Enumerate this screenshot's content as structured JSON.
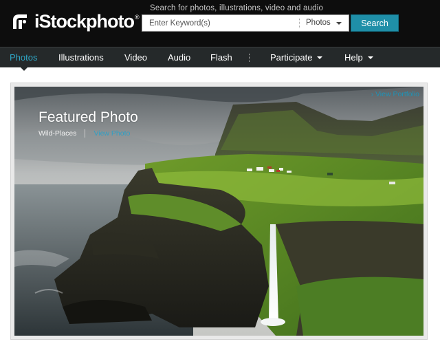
{
  "brand": {
    "name": "iStockphoto",
    "trademark": "®"
  },
  "search": {
    "caption": "Search for photos, illustrations, video and audio",
    "placeholder": "Enter Keyword(s)",
    "category": "Photos",
    "button_label": "Search"
  },
  "nav": {
    "items": [
      {
        "label": "Photos",
        "active": true
      },
      {
        "label": "Illustrations"
      },
      {
        "label": "Video"
      },
      {
        "label": "Audio"
      },
      {
        "label": "Flash"
      },
      {
        "label": "Participate",
        "dropdown": true
      },
      {
        "label": "Help",
        "dropdown": true
      }
    ]
  },
  "featured": {
    "title": "Featured Photo",
    "author": "Wild-Places",
    "view_link": "View Photo",
    "portfolio_link": "› View Portfolio"
  },
  "colors": {
    "accent": "#1f8fa8",
    "nav_active": "#2fa7c6",
    "topbar": "#0d0d0d",
    "navbar": "#25292a"
  }
}
